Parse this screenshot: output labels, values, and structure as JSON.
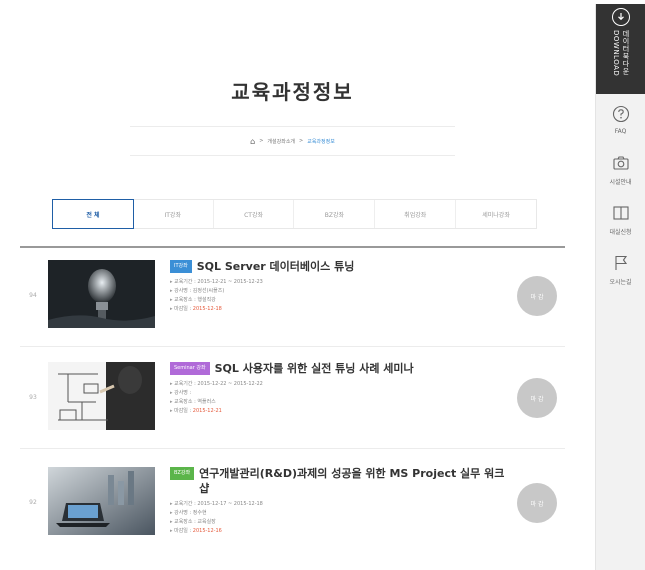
{
  "sidebar": {
    "download": {
      "text_ko": "데이터북다운",
      "text_en": "DOWNLOAD"
    },
    "items": [
      {
        "label": "FAQ",
        "icon": "question-circle-icon"
      },
      {
        "label": "시설안내",
        "icon": "camera-icon"
      },
      {
        "label": "대실신청",
        "icon": "book-icon"
      },
      {
        "label": "오시는길",
        "icon": "flag-icon"
      }
    ]
  },
  "header": {
    "title": "교육과정정보",
    "breadcrumb": {
      "level1": "개설강좌소개",
      "separator": ">",
      "current": "교육과정정보"
    }
  },
  "tabs": [
    {
      "label": "전 체",
      "active": true
    },
    {
      "label": "IT강좌",
      "active": false
    },
    {
      "label": "CT강좌",
      "active": false
    },
    {
      "label": "BZ강좌",
      "active": false
    },
    {
      "label": "취업강좌",
      "active": false
    },
    {
      "label": "세미나강좌",
      "active": false
    }
  ],
  "courses": [
    {
      "num": "94",
      "badge": "IT강좌",
      "badge_color": "#3b8fd6",
      "title": "SQL Server 데이터베이스 튜닝",
      "period": "교육기간 : 2015-12-21 ~ 2015-12-23",
      "instructor": "강사명 : 김정선(씨플즈)",
      "place": "교육장소 : 행설직강",
      "deadline_label": "마감일 : ",
      "deadline": "2015-12-18",
      "status": "마 감"
    },
    {
      "num": "93",
      "badge": "Seminar 강좌",
      "badge_color": "#b06ad8",
      "title": "SQL 사용자를 위한 실전 튜닝 사례 세미나",
      "period": "교육기간 : 2015-12-22 ~ 2015-12-22",
      "instructor": "강사명 :",
      "place": "교육장소 : 역플러스",
      "deadline_label": "마감일 : ",
      "deadline": "2015-12-21",
      "status": "마 감"
    },
    {
      "num": "92",
      "badge": "BZ강좌",
      "badge_color": "#5bb54a",
      "title": "연구개발관리(R&D)과제의 성공을 위한 MS Project 실무 워크샵",
      "period": "교육기간 : 2015-12-17 ~ 2015-12-18",
      "instructor": "강사명 : 정수현",
      "place": "교육장소 : 교육실장",
      "deadline_label": "마감일 : ",
      "deadline": "2015-12-16",
      "status": "마 감"
    }
  ],
  "colors": {
    "accent": "#1f5ea6",
    "deadline": "#e55a3c",
    "sidebar_dark": "#333333"
  }
}
